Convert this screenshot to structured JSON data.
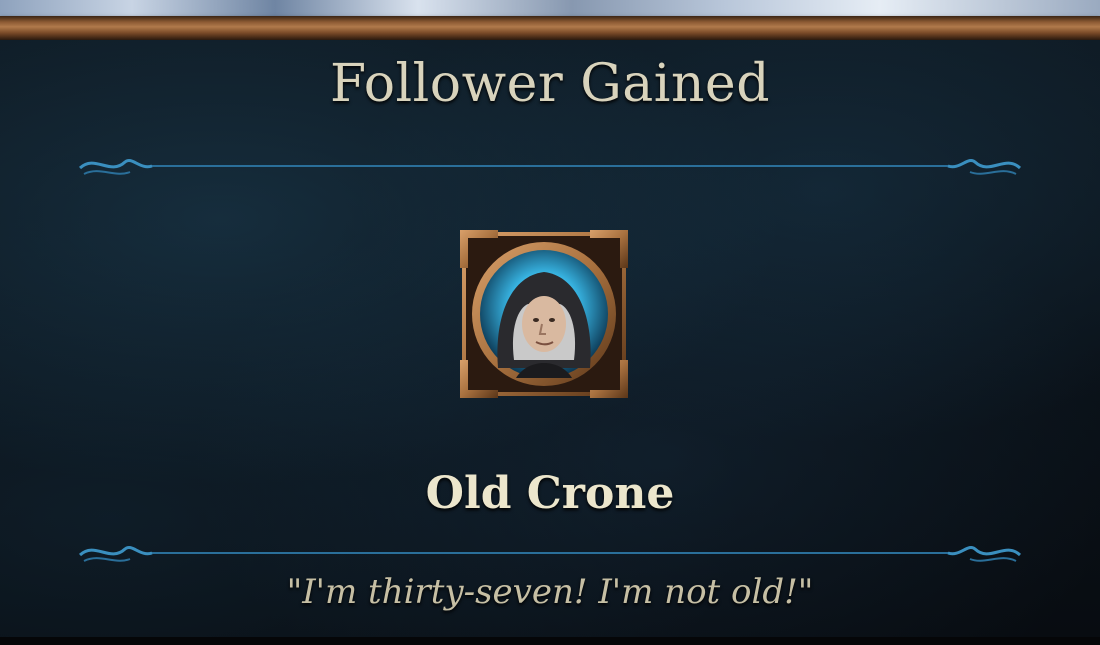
{
  "popup": {
    "title": "Follower Gained",
    "follower_name": "Old Crone",
    "quote": "\"I'm thirty-seven! I'm not old!\"",
    "portrait_icon": "hooded-crone-portrait-icon"
  },
  "colors": {
    "title_text": "#d8d3bc",
    "name_text": "#ece6cc",
    "quote_text": "#c6bfa4",
    "divider_line": "#2a6f9a",
    "frame_bronze": "#a8713f",
    "portrait_glow": "#3cc0f0"
  }
}
